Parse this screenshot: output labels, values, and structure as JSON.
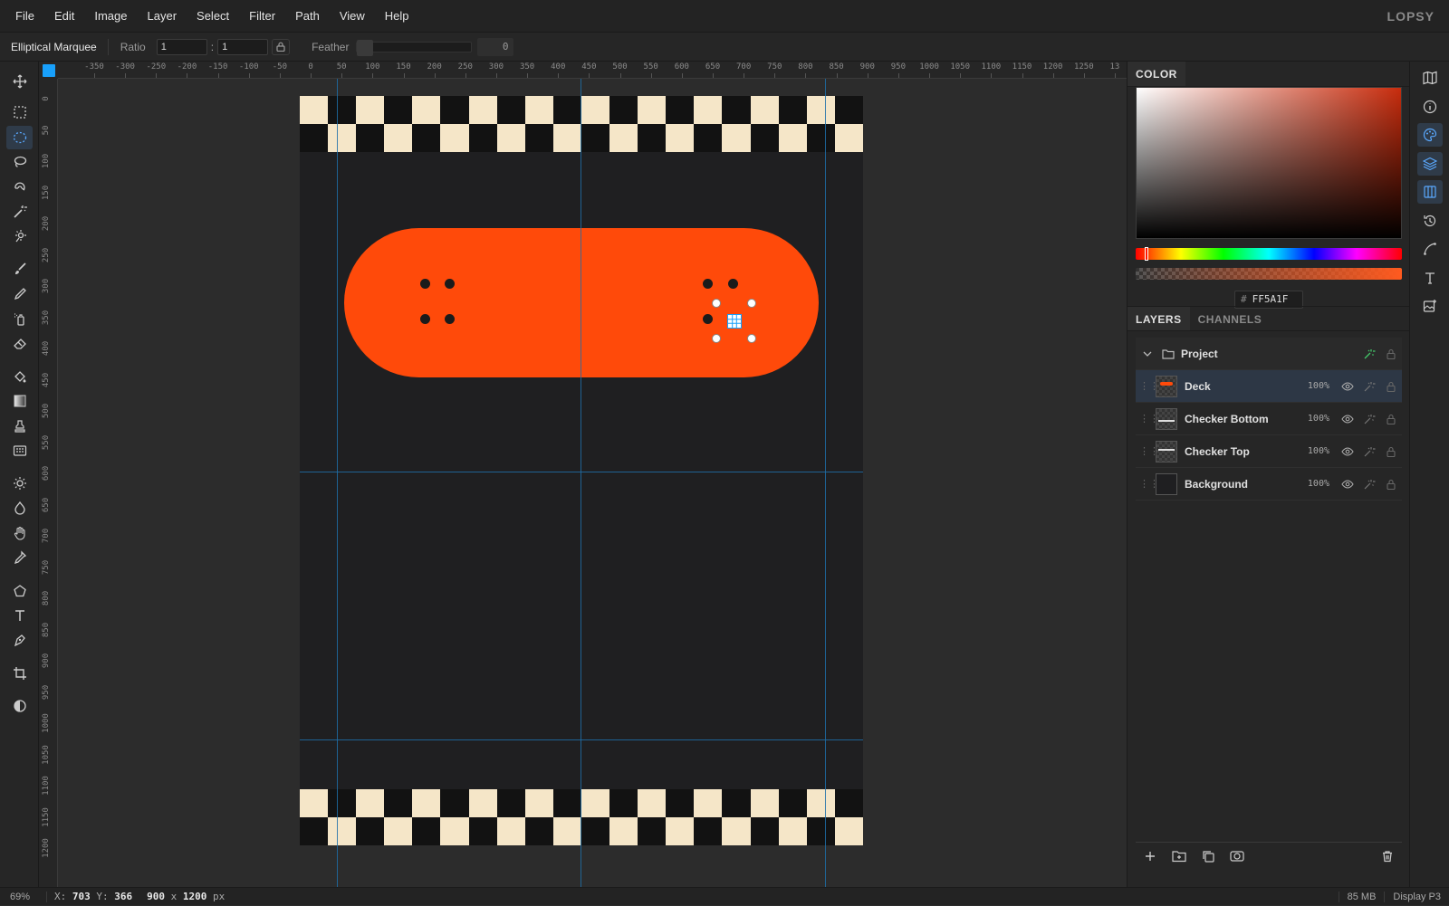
{
  "app": {
    "brand": "LOPSY"
  },
  "menu": [
    "File",
    "Edit",
    "Image",
    "Layer",
    "Select",
    "Filter",
    "Path",
    "View",
    "Help"
  ],
  "options_bar": {
    "tool_name": "Elliptical Marquee",
    "ratio_label": "Ratio",
    "ratio_w": "1",
    "ratio_sep": ":",
    "ratio_h": "1",
    "feather_label": "Feather",
    "feather_value": "0"
  },
  "tools": [
    {
      "name": "move-tool",
      "icon": "move-icon",
      "active": false
    },
    {
      "name": "rect-marquee-tool",
      "icon": "rect-marquee-icon",
      "active": false
    },
    {
      "name": "ellipse-marquee-tool",
      "icon": "ellipse-marquee-icon",
      "active": true
    },
    {
      "name": "lasso-tool",
      "icon": "lasso-icon",
      "active": false
    },
    {
      "name": "magnetic-lasso-tool",
      "icon": "magnetic-lasso-icon",
      "active": false
    },
    {
      "name": "magic-wand-tool",
      "icon": "magic-wand-icon",
      "active": false
    },
    {
      "name": "quick-select-tool",
      "icon": "quick-select-icon",
      "active": false
    },
    {
      "name": "brush-tool",
      "icon": "brush-icon",
      "active": false
    },
    {
      "name": "pencil-tool",
      "icon": "pencil-icon",
      "active": false
    },
    {
      "name": "spray-tool",
      "icon": "spray-icon",
      "active": false
    },
    {
      "name": "eraser-tool",
      "icon": "eraser-icon",
      "active": false
    },
    {
      "name": "fill-tool",
      "icon": "paint-bucket-icon",
      "active": false
    },
    {
      "name": "gradient-tool",
      "icon": "gradient-icon",
      "active": false
    },
    {
      "name": "stamp-tool",
      "icon": "stamp-icon",
      "active": false
    },
    {
      "name": "pattern-tool",
      "icon": "pattern-icon",
      "active": false
    },
    {
      "name": "dodge-tool",
      "icon": "sun-icon",
      "active": false
    },
    {
      "name": "blur-tool",
      "icon": "drop-icon",
      "active": false
    },
    {
      "name": "smudge-tool",
      "icon": "hand-icon",
      "active": false
    },
    {
      "name": "eyedropper-tool",
      "icon": "eyedropper-icon",
      "active": false
    },
    {
      "name": "shape-tool",
      "icon": "pentagon-icon",
      "active": false
    },
    {
      "name": "text-tool",
      "icon": "text-icon",
      "active": false
    },
    {
      "name": "pen-tool",
      "icon": "pen-icon",
      "active": false
    },
    {
      "name": "crop-tool",
      "icon": "crop-icon",
      "active": false
    },
    {
      "name": "mask-toggle",
      "icon": "contrast-icon",
      "active": false
    }
  ],
  "ruler": {
    "h_labels": [
      "-350",
      "-300",
      "-250",
      "-200",
      "-150",
      "-100",
      "-50",
      "0",
      "50",
      "100",
      "150",
      "200",
      "250",
      "300",
      "350",
      "400",
      "450",
      "500",
      "550",
      "600",
      "650",
      "700",
      "750",
      "800",
      "850",
      "900",
      "950",
      "1000",
      "1050",
      "1100",
      "1150",
      "1200",
      "1250",
      "13"
    ],
    "v_labels": [
      "0",
      "50",
      "100",
      "150",
      "200",
      "250",
      "300",
      "350",
      "400",
      "450",
      "500",
      "550",
      "600",
      "650",
      "700",
      "750",
      "800",
      "850",
      "900",
      "950",
      "1000",
      "1050",
      "1100",
      "1150",
      "1200"
    ]
  },
  "document": {
    "deck_color": "#FF4A0A",
    "checker_light": "#F5E6C8",
    "checker_dark": "#121212",
    "background": "#1F1F21"
  },
  "color_panel": {
    "tab": "COLOR",
    "hex_prefix": "#",
    "hex": "FF5A1F"
  },
  "layers_panel": {
    "tabs": [
      "LAYERS",
      "CHANNELS"
    ],
    "group": {
      "name": "Project"
    },
    "layers": [
      {
        "name": "Deck",
        "opacity": "100%",
        "selected": true
      },
      {
        "name": "Checker Bottom",
        "opacity": "100%",
        "selected": false
      },
      {
        "name": "Checker Top",
        "opacity": "100%",
        "selected": false
      },
      {
        "name": "Background",
        "opacity": "100%",
        "selected": false
      }
    ]
  },
  "status": {
    "zoom": "69%",
    "x_label": "X:",
    "x": "703",
    "y_label": "Y:",
    "y": "366",
    "width": "900",
    "dim_sep": "x",
    "height": "1200",
    "unit": "px",
    "memory": "85 MB",
    "color_profile": "Display P3"
  }
}
